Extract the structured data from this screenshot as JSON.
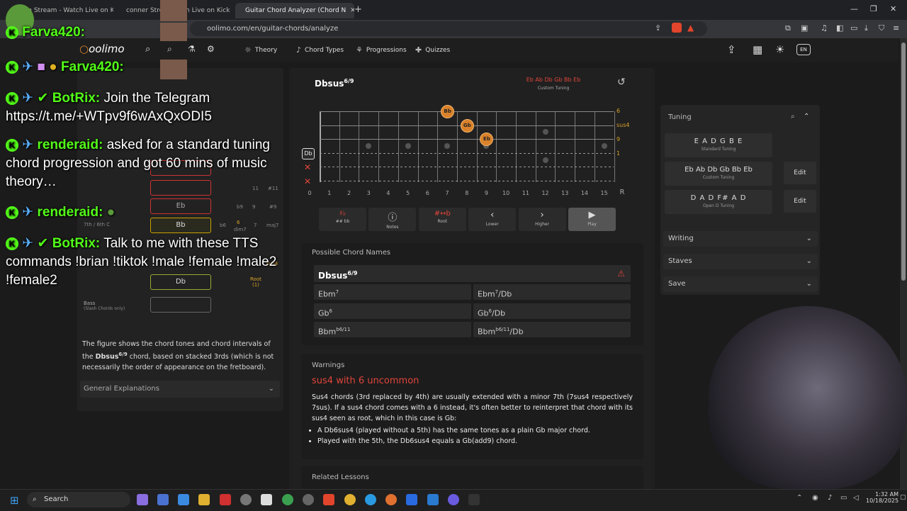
{
  "browser": {
    "tabs": [
      {
        "label": "Man Stream - Watch Live on K"
      },
      {
        "label": "conner Stre"
      },
      {
        "label": "h Live on Kick"
      },
      {
        "label": "Guitar Chord Analyzer (Chord N"
      }
    ],
    "url": "oolimo.com/en/guitar-chords/analyze"
  },
  "sitenav": {
    "logo": "oolimo",
    "items": [
      "Theory",
      "Chord Types",
      "Progressions",
      "Quizzes"
    ],
    "lang": "EN"
  },
  "left_panel": {
    "chord_boxes": [
      "",
      "Eb",
      "Bb",
      "Db",
      ""
    ],
    "intervals_right": [
      "11",
      "#11",
      "b9",
      "9",
      "#9",
      "b6",
      "6",
      "dim7",
      "7",
      "maj7"
    ],
    "sus4_label": "sus4",
    "root_label": "Root",
    "root_sub": "(1)",
    "bass_label": "Bass",
    "bass_sub": "(Slash Chords only)",
    "row_label_6th": "7th / 6th C",
    "description_pre": "The figure shows the chord tones and chord intervals of the ",
    "description_chord": "Dbsus",
    "description_chord_sup": "6/9",
    "description_post": " chord, based on stacked 3rds (which is not necessarily the order of appearance on the fretboard).",
    "general_explanations": "General Explanations"
  },
  "fretboard": {
    "chord_name": "Dbsus",
    "chord_sup": "6/9",
    "tuning_notes": "Eb Ab Db Gb Bb Eb",
    "tuning_label": "Custom Tuning",
    "open_string_label": "Db",
    "right_labels": [
      "6",
      "sus4",
      "9",
      "1"
    ],
    "notes": [
      {
        "label": "Bb",
        "fret": 7,
        "string": 1
      },
      {
        "label": "Gb",
        "fret": 8,
        "string": 2
      },
      {
        "label": "Eb",
        "fret": 9,
        "string": 3
      }
    ],
    "fret_numbers": [
      "0",
      "1",
      "2",
      "3",
      "4",
      "5",
      "6",
      "7",
      "8",
      "9",
      "10",
      "11",
      "12",
      "13",
      "14",
      "15",
      "R"
    ],
    "toolbar": [
      {
        "label": "## bb",
        "icon": "sharp-flat-icon"
      },
      {
        "label": "Notes",
        "icon": "info-icon"
      },
      {
        "label": "Root",
        "icon": "root-icon"
      },
      {
        "label": "Lower",
        "icon": "chevron-left-icon"
      },
      {
        "label": "Higher",
        "icon": "chevron-right-icon"
      },
      {
        "label": "Play",
        "icon": "play-icon"
      }
    ]
  },
  "possible_names": {
    "title": "Possible Chord Names",
    "main": "Dbsus",
    "main_sup": "6/9",
    "cells": [
      {
        "base": "Ebm",
        "sup": "7",
        "tail": ""
      },
      {
        "base": "Ebm",
        "sup": "7",
        "tail": "/Db"
      },
      {
        "base": "Gb",
        "sup": "6",
        "tail": ""
      },
      {
        "base": "Gb",
        "sup": "6",
        "tail": "/Db"
      },
      {
        "base": "Bbm",
        "sup": "b6/11",
        "tail": ""
      },
      {
        "base": "Bbm",
        "sup": "b6/11",
        "tail": "/Db"
      }
    ]
  },
  "warnings": {
    "title": "Warnings",
    "heading": "sus4 with 6 uncommon",
    "body": "Sus4 chords (3rd replaced by 4th) are usually extended with a minor 7th (7sus4 respectively 7sus). If a sus4 chord comes with a 6 instead, it's often better to reinterpret that chord with its sus4 seen as root, which in this case is Gb:",
    "bullets": [
      "A Db6sus4 (played without a 5th) has the same tones as a plain Gb major chord.",
      "Played with the 5th, the Db6sus4 equals a Gb(add9) chord."
    ],
    "related": "Related Lessons"
  },
  "right_panel": {
    "tuning_title": "Tuning",
    "tunings": [
      {
        "notes": "E A D G B E",
        "label": "Standard Tuning",
        "edit": ""
      },
      {
        "notes": "Eb Ab Db Gb Bb Eb",
        "label": "Custom Tuning",
        "edit": "Edit"
      },
      {
        "notes": "D A D F# A D",
        "label": "Open D Tuning",
        "edit": "Edit"
      }
    ],
    "sections": [
      "Writing",
      "Staves",
      "Save"
    ]
  },
  "chat": [
    {
      "user": "Farva420:",
      "text": ""
    },
    {
      "user": "Farva420:",
      "text": ""
    },
    {
      "user": "BotRix:",
      "text": "Join the Telegram https://t.me/+WTpv9f6wAxQxODI5"
    },
    {
      "user": "renderaid:",
      "text": "asked for a standard tuning chord progression and got 60 mins of music theory…"
    },
    {
      "user": "renderaid:",
      "text": ""
    },
    {
      "user": "BotRix:",
      "text": "Talk to me with these TTS commands !brian !tiktok !male !female !male2 !female2"
    }
  ],
  "taskbar": {
    "search": "Search",
    "time": "1:32 AM",
    "date": "10/18/2025"
  },
  "colors": {
    "accent_orange": "#d9822b",
    "warning_red": "#e0453a",
    "kick_green": "#53fc18"
  }
}
